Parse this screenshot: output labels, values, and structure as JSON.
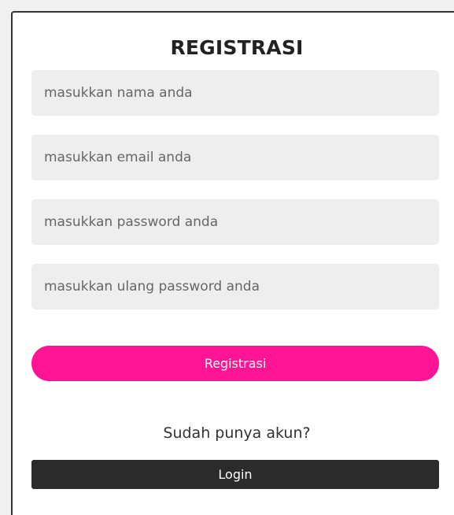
{
  "form": {
    "title": "REGISTRASI",
    "fields": {
      "name": {
        "placeholder": "masukkan nama anda",
        "value": ""
      },
      "email": {
        "placeholder": "masukkan email anda",
        "value": ""
      },
      "password": {
        "placeholder": "masukkan password anda",
        "value": ""
      },
      "confirm_password": {
        "placeholder": "masukkan ulang password anda",
        "value": ""
      }
    },
    "register_button_label": "Registrasi",
    "have_account_text": "Sudah punya akun?",
    "login_button_label": "Login"
  },
  "colors": {
    "accent": "#ff1493",
    "login_button": "#2b2b2b",
    "input_background": "#eeeeee"
  }
}
